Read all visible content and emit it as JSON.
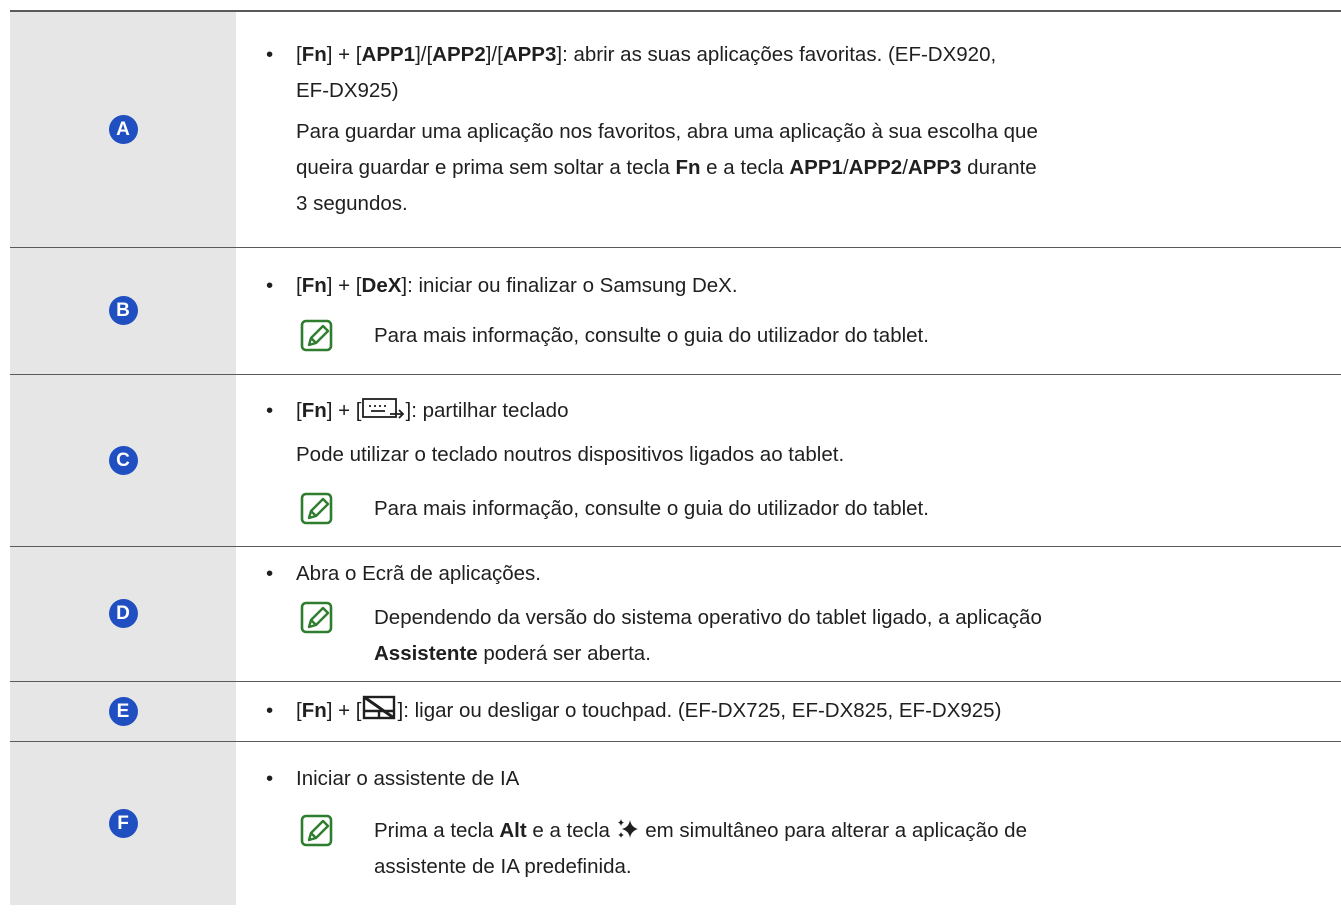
{
  "rows": [
    {
      "key": "A",
      "bullet": {
        "p1": "[",
        "fn": "Fn",
        "p2": "] + [",
        "k1": "APP1",
        "p3": "]/[",
        "k2": "APP2",
        "p4": "]/[",
        "k3": "APP3",
        "p5": "]: abrir as suas aplicações favoritas. (EF-DX920,",
        "p6": "EF-DX925)"
      },
      "para": {
        "t1": "Para guardar uma aplicação nos favoritos, abra uma aplicação à sua escolha que",
        "t2": "queira guardar e prima sem soltar a tecla ",
        "fn": "Fn",
        "t3": " e a tecla ",
        "k1": "APP1",
        "s1": "/",
        "k2": "APP2",
        "s2": "/",
        "k3": "APP3",
        "t4": " durante",
        "t5": "3 segundos."
      }
    },
    {
      "key": "B",
      "bullet": {
        "p1": "[",
        "fn": "Fn",
        "p2": "] + [",
        "k1": "DeX",
        "p3": "]: iniciar ou finalizar o Samsung DeX."
      },
      "note": "Para mais informação, consulte o guia do utilizador do tablet."
    },
    {
      "key": "C",
      "bullet": {
        "p1": "[",
        "fn": "Fn",
        "p2": "] + [",
        "p3": "]: partilhar teclado"
      },
      "para": "Pode utilizar o teclado noutros dispositivos ligados ao tablet.",
      "note": "Para mais informação, consulte o guia do utilizador do tablet.",
      "icon": "keyboard-share-icon"
    },
    {
      "key": "D",
      "bullet": "Abra o Ecrã de aplicações.",
      "note": {
        "t1": "Dependendo da versão do sistema operativo do tablet ligado, a aplicação",
        "b1": "Assistente",
        "t2": " poderá ser aberta."
      }
    },
    {
      "key": "E",
      "bullet": {
        "p1": "[",
        "fn": "Fn",
        "p2": "] + [",
        "p3": "]: ligar ou desligar o touchpad. (EF-DX725, EF-DX825, EF-DX925)"
      },
      "icon": "touchpad-off-icon"
    },
    {
      "key": "F",
      "bullet": "Iniciar o assistente de IA",
      "note": {
        "t1": "Prima a tecla ",
        "b1": "Alt",
        "t2": " e a tecla ",
        "t3": " em simultâneo para alterar a aplicação de",
        "t4": "assistente de IA predefinida."
      },
      "icon": "ai-sparkle-icon"
    }
  ],
  "bullet_char": "•",
  "note_icon": "note-pencil-icon",
  "colors": {
    "badge": "#1f4fc1",
    "key_cell_bg": "#e6e6e6",
    "note_icon": "#2f7d2f",
    "text": "#1f1f1f"
  }
}
